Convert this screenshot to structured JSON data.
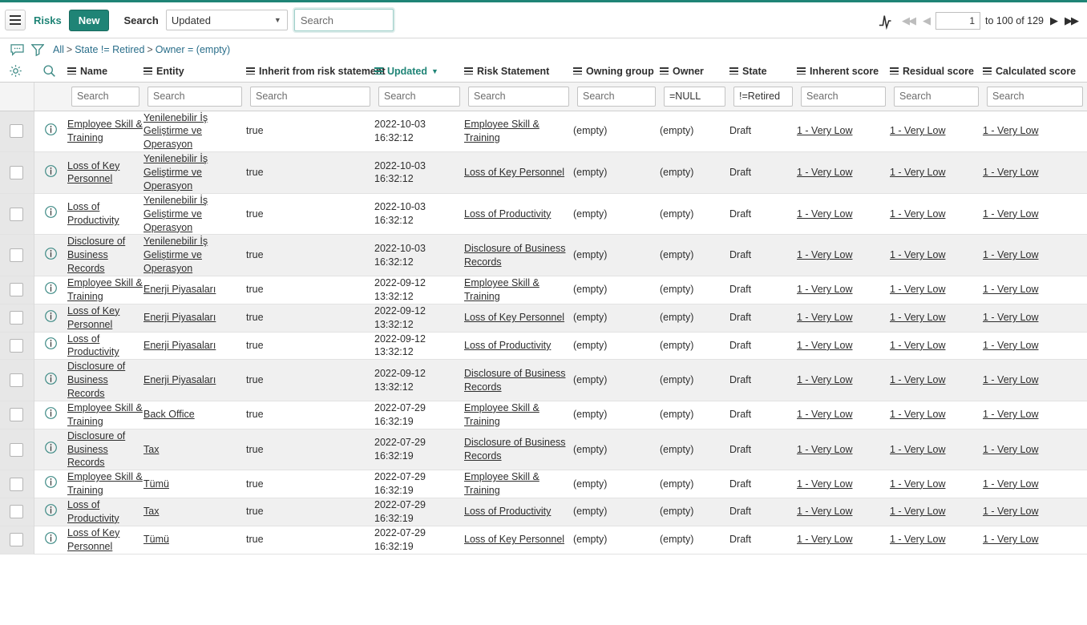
{
  "theme": {
    "accent": "#1f8476",
    "link": "#2a6e8a",
    "row_alt": "#f0f0f0"
  },
  "toolbar": {
    "menu_icon": "hamburger-icon",
    "module_link": "Risks",
    "new_label": "New",
    "search_label": "Search",
    "search_field_value": "Updated",
    "search_placeholder": "Search",
    "search_value": ""
  },
  "pager": {
    "chart_icon": "activity-pulse-icon",
    "first_icon": "first-page-icon",
    "prev_icon": "previous-page-icon",
    "page_value": "1",
    "range_text": "to 100 of 129",
    "next_icon": "next-page-icon",
    "last_icon": "last-page-icon"
  },
  "breadcrumb": {
    "comment_icon": "comment-icon",
    "filter_icon": "funnel-icon",
    "gear_icon": "gear-icon",
    "magnifier_icon": "search-icon",
    "parts": [
      "All",
      "State != Retired",
      "Owner = (empty)"
    ],
    "text": "All > State != Retired > Owner = (empty)"
  },
  "table": {
    "columns": [
      {
        "key": "name",
        "label": "Name",
        "sorted": false,
        "filter": "",
        "filter_placeholder": "Search"
      },
      {
        "key": "ent",
        "label": "Entity",
        "sorted": false,
        "filter": "",
        "filter_placeholder": "Search"
      },
      {
        "key": "inh",
        "label": "Inherit from risk statement",
        "sorted": false,
        "filter": "",
        "filter_placeholder": "Search"
      },
      {
        "key": "upd",
        "label": "Updated",
        "sorted": true,
        "sort_dir": "desc",
        "filter": "",
        "filter_placeholder": "Search"
      },
      {
        "key": "rs",
        "label": "Risk Statement",
        "sorted": false,
        "filter": "",
        "filter_placeholder": "Search"
      },
      {
        "key": "og",
        "label": "Owning group",
        "sorted": false,
        "filter": "",
        "filter_placeholder": "Search"
      },
      {
        "key": "own",
        "label": "Owner",
        "sorted": false,
        "filter": "=NULL",
        "filter_placeholder": "Search"
      },
      {
        "key": "state",
        "label": "State",
        "sorted": false,
        "filter": "!=Retired",
        "filter_placeholder": "Search"
      },
      {
        "key": "is",
        "label": "Inherent score",
        "sorted": false,
        "filter": "",
        "filter_placeholder": "Search"
      },
      {
        "key": "rsc",
        "label": "Residual score",
        "sorted": false,
        "filter": "",
        "filter_placeholder": "Search"
      },
      {
        "key": "cs",
        "label": "Calculated score",
        "sorted": false,
        "filter": "",
        "filter_placeholder": "Search"
      }
    ],
    "rows": [
      {
        "name": "Employee Skill & Training",
        "ent": "Yenilenebilir İş Geliştirme ve Operasyon",
        "inh": "true",
        "upd": "2022-10-03 16:32:12",
        "rs": "Employee Skill & Training",
        "og": "(empty)",
        "own": "(empty)",
        "state": "Draft",
        "is": "1 - Very Low",
        "rsc": "1 - Very Low",
        "cs": "1 - Very Low"
      },
      {
        "name": "Loss of Key Personnel",
        "ent": "Yenilenebilir İş Geliştirme ve Operasyon",
        "inh": "true",
        "upd": "2022-10-03 16:32:12",
        "rs": "Loss of Key Personnel",
        "og": "(empty)",
        "own": "(empty)",
        "state": "Draft",
        "is": "1 - Very Low",
        "rsc": "1 - Very Low",
        "cs": "1 - Very Low"
      },
      {
        "name": "Loss of Productivity",
        "ent": "Yenilenebilir İş Geliştirme ve Operasyon",
        "inh": "true",
        "upd": "2022-10-03 16:32:12",
        "rs": "Loss of Productivity",
        "og": "(empty)",
        "own": "(empty)",
        "state": "Draft",
        "is": "1 - Very Low",
        "rsc": "1 - Very Low",
        "cs": "1 - Very Low"
      },
      {
        "name": "Disclosure of Business Records",
        "ent": "Yenilenebilir İş Geliştirme ve Operasyon",
        "inh": "true",
        "upd": "2022-10-03 16:32:12",
        "rs": "Disclosure of Business Records",
        "og": "(empty)",
        "own": "(empty)",
        "state": "Draft",
        "is": "1 - Very Low",
        "rsc": "1 - Very Low",
        "cs": "1 - Very Low"
      },
      {
        "name": "Employee Skill & Training",
        "ent": "Enerji Piyasaları",
        "inh": "true",
        "upd": "2022-09-12 13:32:12",
        "rs": "Employee Skill & Training",
        "og": "(empty)",
        "own": "(empty)",
        "state": "Draft",
        "is": "1 - Very Low",
        "rsc": "1 - Very Low",
        "cs": "1 - Very Low"
      },
      {
        "name": "Loss of Key Personnel",
        "ent": "Enerji Piyasaları",
        "inh": "true",
        "upd": "2022-09-12 13:32:12",
        "rs": "Loss of Key Personnel",
        "og": "(empty)",
        "own": "(empty)",
        "state": "Draft",
        "is": "1 - Very Low",
        "rsc": "1 - Very Low",
        "cs": "1 - Very Low"
      },
      {
        "name": "Loss of Productivity",
        "ent": "Enerji Piyasaları",
        "inh": "true",
        "upd": "2022-09-12 13:32:12",
        "rs": "Loss of Productivity",
        "og": "(empty)",
        "own": "(empty)",
        "state": "Draft",
        "is": "1 - Very Low",
        "rsc": "1 - Very Low",
        "cs": "1 - Very Low"
      },
      {
        "name": "Disclosure of Business Records",
        "ent": "Enerji Piyasaları",
        "inh": "true",
        "upd": "2022-09-12 13:32:12",
        "rs": "Disclosure of Business Records",
        "og": "(empty)",
        "own": "(empty)",
        "state": "Draft",
        "is": "1 - Very Low",
        "rsc": "1 - Very Low",
        "cs": "1 - Very Low"
      },
      {
        "name": "Employee Skill & Training",
        "ent": "Back Office",
        "inh": "true",
        "upd": "2022-07-29 16:32:19",
        "rs": "Employee Skill & Training",
        "og": "(empty)",
        "own": "(empty)",
        "state": "Draft",
        "is": "1 - Very Low",
        "rsc": "1 - Very Low",
        "cs": "1 - Very Low"
      },
      {
        "name": "Disclosure of Business Records",
        "ent": "Tax",
        "inh": "true",
        "upd": "2022-07-29 16:32:19",
        "rs": "Disclosure of Business Records",
        "og": "(empty)",
        "own": "(empty)",
        "state": "Draft",
        "is": "1 - Very Low",
        "rsc": "1 - Very Low",
        "cs": "1 - Very Low"
      },
      {
        "name": "Employee Skill & Training",
        "ent": "Tümü",
        "inh": "true",
        "upd": "2022-07-29 16:32:19",
        "rs": "Employee Skill & Training",
        "og": "(empty)",
        "own": "(empty)",
        "state": "Draft",
        "is": "1 - Very Low",
        "rsc": "1 - Very Low",
        "cs": "1 - Very Low"
      },
      {
        "name": "Loss of Productivity",
        "ent": "Tax",
        "inh": "true",
        "upd": "2022-07-29 16:32:19",
        "rs": "Loss of Productivity",
        "og": "(empty)",
        "own": "(empty)",
        "state": "Draft",
        "is": "1 - Very Low",
        "rsc": "1 - Very Low",
        "cs": "1 - Very Low"
      },
      {
        "name": "Loss of Key Personnel",
        "ent": "Tümü",
        "inh": "true",
        "upd": "2022-07-29 16:32:19",
        "rs": "Loss of Key Personnel",
        "og": "(empty)",
        "own": "(empty)",
        "state": "Draft",
        "is": "1 - Very Low",
        "rsc": "1 - Very Low",
        "cs": "1 - Very Low"
      }
    ],
    "row_icons": {
      "checkbox": "row-checkbox",
      "info": "info-circle-icon"
    }
  }
}
